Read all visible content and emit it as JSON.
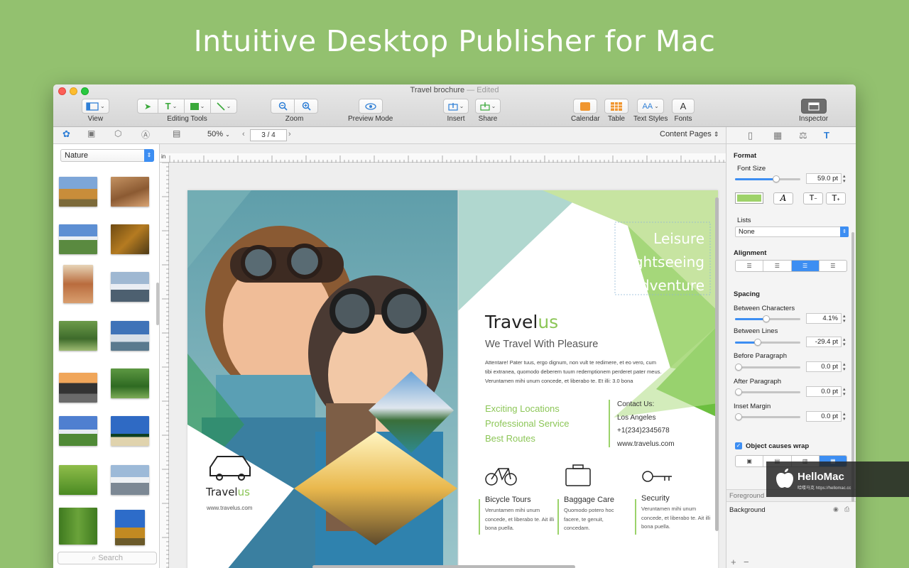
{
  "headline": "Intuitive Desktop Publisher for Mac",
  "window": {
    "title": "Travel brochure",
    "edited": "— Edited"
  },
  "toolbar": {
    "view_label": "View",
    "editing_tools_label": "Editing Tools",
    "zoom_label": "Zoom",
    "preview_label": "Preview Mode",
    "insert_label": "Insert",
    "share_label": "Share",
    "calendar_label": "Calendar",
    "table_label": "Table",
    "text_styles_label": "Text Styles",
    "fonts_label": "Fonts",
    "inspector_label": "Inspector",
    "text_tool_glyph": "T",
    "text_styles_glyph": "AA",
    "fonts_glyph": "A"
  },
  "subbar": {
    "zoom": "50%",
    "page": "3 / 4",
    "content_pages": "Content Pages"
  },
  "sidebar": {
    "category": "Nature",
    "search_placeholder": "Search"
  },
  "ruler": {
    "unit": "in"
  },
  "brochure": {
    "tags": [
      "Leisure",
      "Sightseeing",
      "Adventure"
    ],
    "brand_a": "Travel",
    "brand_b": "us",
    "tagline": "We Travel With Pleasure",
    "body": "Attentare! Pater tuus, ergo dignum, non vult te redimere, et eo vero, cum tibi extranea, quomodo deberem tuum redemptionem perderet pater meus. Veruntamen mihi unum concede, et liberabo te. Et illi: 3.0 bona",
    "features": [
      "Exciting Locations",
      "Professional Service",
      "Best Routes"
    ],
    "contact_title": "Contact Us:",
    "contact_city": "Los Angeles",
    "contact_phone": "+1(234)2345678",
    "contact_web": "www.travelus.com",
    "services": [
      {
        "title": "Bicycle Tours",
        "text": "Veruntamen mihi unum concede, et liberabo te. Ait illi bona puella."
      },
      {
        "title": "Baggage Care",
        "text": "Quomodo potero hoc facere, te genuit, concedam."
      },
      {
        "title": "Security",
        "text": "Veruntamen mihi unum concede, et liberabo te. Ait illi bona puella."
      }
    ],
    "footer_brand_a": "Travel",
    "footer_brand_b": "us",
    "footer_web": "www.travelus.com"
  },
  "inspector": {
    "format": "Format",
    "font_size_label": "Font Size",
    "font_size": "59.0 pt",
    "font_size_level": 0.65,
    "italic_glyph": "A",
    "size_down_glyph": "T",
    "size_up_glyph": "T",
    "lists_label": "Lists",
    "lists_value": "None",
    "alignment_label": "Alignment",
    "spacing_label": "Spacing",
    "between_chars_label": "Between Characters",
    "between_chars": "4.1%",
    "between_chars_level": 0.48,
    "between_lines_label": "Between Lines",
    "between_lines": "-29.4 pt",
    "between_lines_level": 0.33,
    "before_para_label": "Before Paragraph",
    "before_para": "0.0 pt",
    "before_para_level": 0.0,
    "after_para_label": "After Paragraph",
    "after_para": "0.0 pt",
    "after_para_level": 0.0,
    "inset_label": "Inset Margin",
    "inset": "0.0 pt",
    "inset_level": 0.0,
    "wrap_label": "Object causes wrap",
    "foreground_label": "Foreground",
    "background_label": "Background",
    "text_color": "#9ed26a"
  },
  "watermark": {
    "brand": "HelloMac",
    "sub": "哈喽马克 https://hellomac.cc"
  }
}
